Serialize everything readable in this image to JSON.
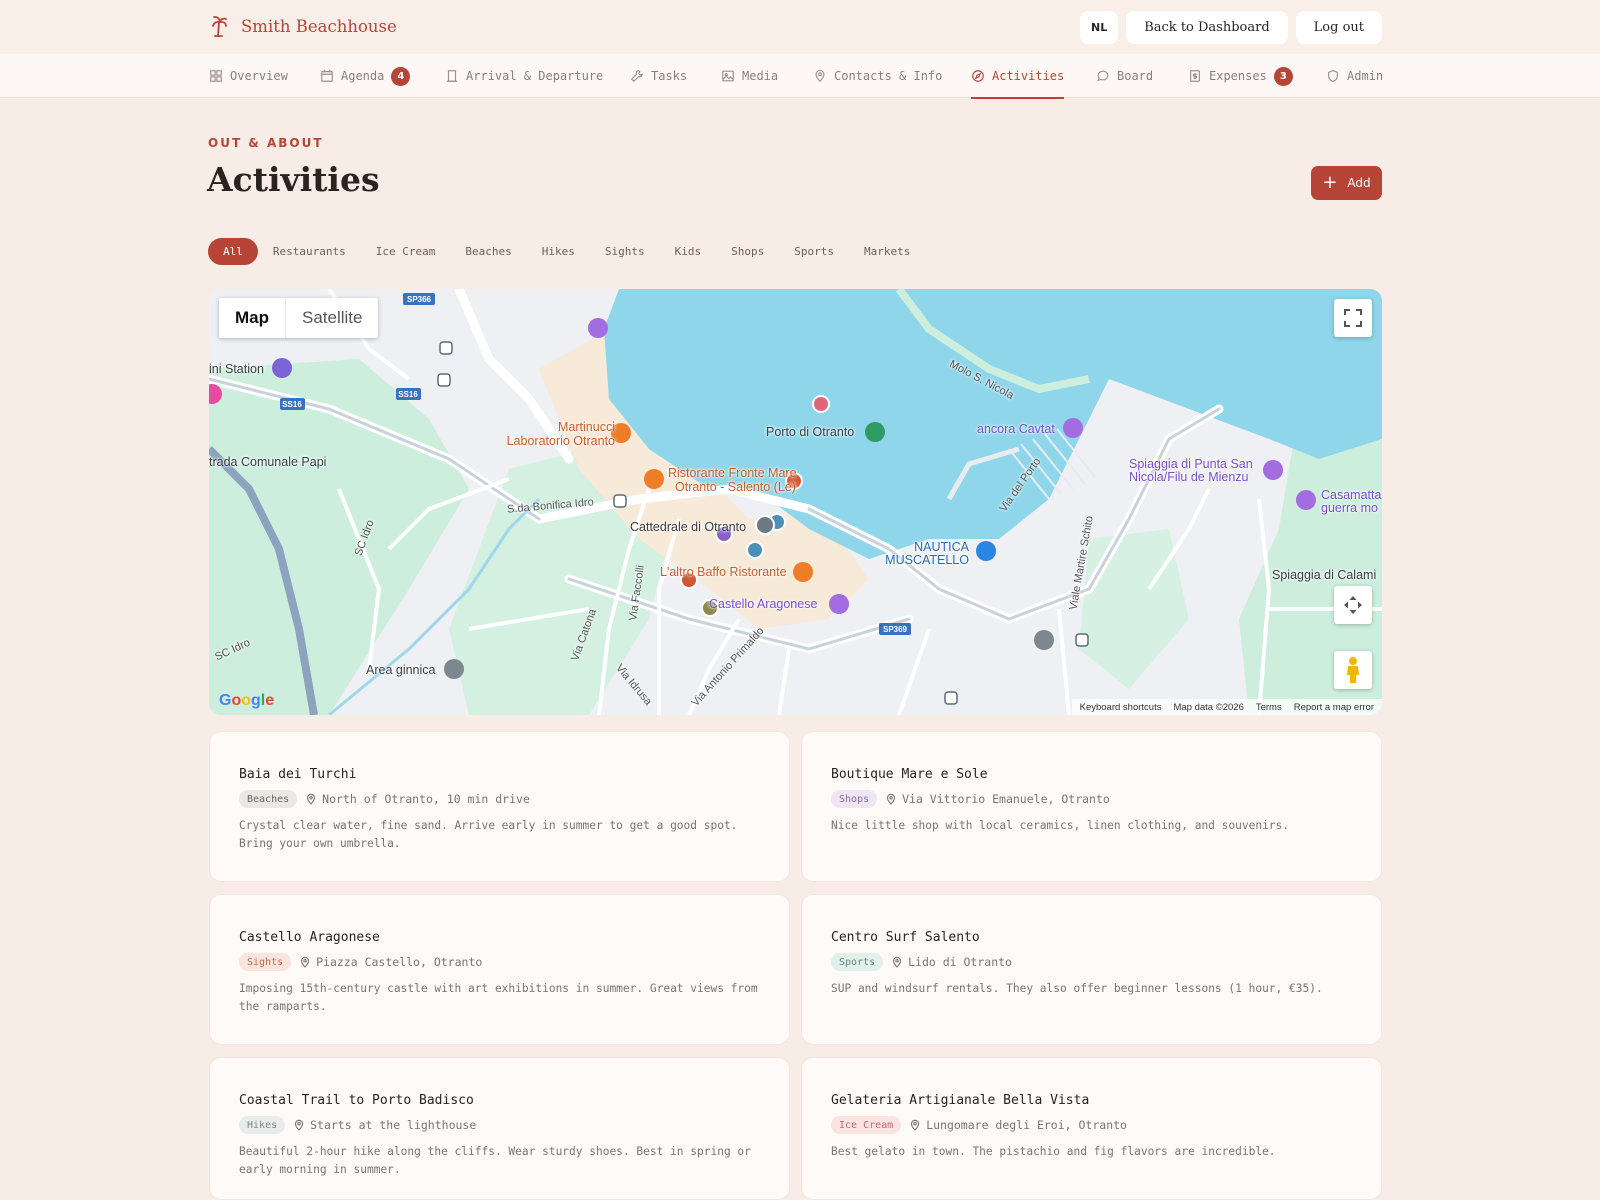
{
  "header": {
    "brand_name": "Smith Beachhouse",
    "lang_label": "NL",
    "back_label": "Back to Dashboard",
    "logout_label": "Log out"
  },
  "nav": {
    "items": [
      {
        "label": "Overview",
        "icon": "grid-icon"
      },
      {
        "label": "Agenda",
        "icon": "calendar-icon",
        "badge": "4"
      },
      {
        "label": "Arrival & Departure",
        "icon": "building-icon"
      },
      {
        "label": "Tasks",
        "icon": "wrench-icon"
      },
      {
        "label": "Media",
        "icon": "image-icon"
      },
      {
        "label": "Contacts & Info",
        "icon": "map-pin-icon"
      },
      {
        "label": "Activities",
        "icon": "compass-icon",
        "active": true
      },
      {
        "label": "Board",
        "icon": "chat-bubble-icon"
      },
      {
        "label": "Expenses",
        "icon": "receipt-icon",
        "badge": "3"
      },
      {
        "label": "Admin",
        "icon": "shield-icon"
      }
    ]
  },
  "page": {
    "eyebrow": "OUT & ABOUT",
    "title": "Activities",
    "add_label": "Add"
  },
  "filters": [
    "All",
    "Restaurants",
    "Ice Cream",
    "Beaches",
    "Hikes",
    "Sights",
    "Kids",
    "Shops",
    "Sports",
    "Markets"
  ],
  "map": {
    "type_map": "Map",
    "type_satellite": "Satellite",
    "labels": {
      "station": "ini Station",
      "strada": "trada Comunale Papi",
      "martinucci_1": "Martinucci",
      "martinucci_2": "Laboratorio Otranto",
      "ristorante_1": "Ristorante Fronte Mare",
      "ristorante_2": "Otranto - Salento (Le)",
      "porto": "Porto di Otranto",
      "ancora": "ancora Cavtat",
      "spiaggia_1": "Spiaggia di Punta San",
      "spiaggia_2": "Nicola/Filu de Mienzu",
      "casamatta_1": "Casamatta",
      "casamatta_2": "guerra mo",
      "cattedrale": "Cattedrale di Otranto",
      "nautica_1": "NAUTICA",
      "nautica_2": "MUSCATELLO",
      "laltro": "L'altro Baffo Ristorante",
      "castello": "Castello Aragonese",
      "spiaggia_calami": "Spiaggia di Calami",
      "area_ginnica": "Area ginnica",
      "molo": "Molo S. Nicola",
      "via_del_porto": "Via del Porto",
      "viale_schito": "Viale Martire Schito",
      "sc_idro": "SC Idro",
      "sc_idro2": "SC Idro",
      "bonifica": "S.da Bonifica Idro",
      "via_catona": "Via Catona",
      "via_faccolli": "Via Faccolli",
      "via_primaldo": "Via Antonio Primaldo",
      "via_idrusa": "Via Idrusa",
      "ss16a": "SS16",
      "ss16b": "SS16",
      "sp366": "SP366",
      "sp369": "SP369"
    },
    "footer": [
      "Keyboard shortcuts",
      "Map data ©2026",
      "Terms",
      "Report a map error"
    ],
    "google": "Google"
  },
  "activities": [
    {
      "title": "Baia dei Turchi",
      "category": "Beaches",
      "location": "North of Otranto, 10 min drive",
      "description": "Crystal clear water, fine sand. Arrive early in summer to get a good spot. Bring your own umbrella.",
      "tag_bg": "#ebe7e3",
      "tag_fg": "#6e645f"
    },
    {
      "title": "Boutique Mare e Sole",
      "category": "Shops",
      "location": "Via Vittorio Emanuele, Otranto",
      "description": "Nice little shop with local ceramics, linen clothing, and souvenirs.",
      "tag_bg": "#efe6f3",
      "tag_fg": "#8b6a9b"
    },
    {
      "title": "Castello Aragonese",
      "category": "Sights",
      "location": "Piazza Castello, Otranto",
      "description": "Imposing 15th-century castle with art exhibitions in summer. Great views from the ramparts.",
      "tag_bg": "#fae4dc",
      "tag_fg": "#c26a52"
    },
    {
      "title": "Centro Surf Salento",
      "category": "Sports",
      "location": "Lido di Otranto",
      "description": "SUP and windsurf rentals. They also offer beginner lessons (1 hour, €35).",
      "tag_bg": "#e3efea",
      "tag_fg": "#5a8c78"
    },
    {
      "title": "Coastal Trail to Porto Badisco",
      "category": "Hikes",
      "location": "Starts at the lighthouse",
      "description": "Beautiful 2-hour hike along the cliffs. Wear sturdy shoes. Best in spring or early morning in summer.",
      "tag_bg": "#e8eceb",
      "tag_fg": "#7d8886"
    },
    {
      "title": "Gelateria Artigianale Bella Vista",
      "category": "Ice Cream",
      "location": "Lungomare degli Eroi, Otranto",
      "description": "Best gelato in town. The pistachio and fig flavors are incredible.",
      "tag_bg": "#fbe3e2",
      "tag_fg": "#cc6a6a"
    }
  ],
  "colors": {
    "accent": "#b64538",
    "background": "#f8ece6",
    "water": "#8fd6ea",
    "park": "#cdeedd"
  }
}
